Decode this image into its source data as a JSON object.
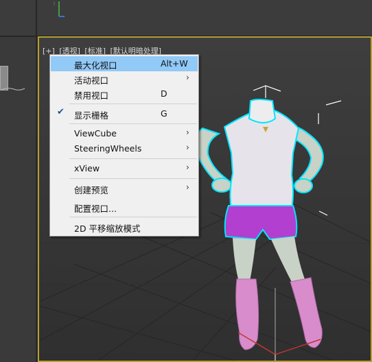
{
  "viewport_label": {
    "plus": "[+]",
    "view": "[透视]",
    "mode": "[标准]",
    "shading": "[默认明暗处理]"
  },
  "context_menu": {
    "items": [
      {
        "label": "最大化视口",
        "shortcut": "Alt+W",
        "submenu": false,
        "checked": false,
        "highlighted": true
      },
      {
        "label": "活动视口",
        "shortcut": "",
        "submenu": true,
        "checked": false,
        "highlighted": false
      },
      {
        "label": "禁用视口",
        "shortcut": "D",
        "submenu": false,
        "checked": false,
        "highlighted": false
      },
      {
        "label": "显示栅格",
        "shortcut": "G",
        "submenu": false,
        "checked": true,
        "highlighted": false
      },
      {
        "label": "ViewCube",
        "shortcut": "",
        "submenu": true,
        "checked": false,
        "highlighted": false
      },
      {
        "label": "SteeringWheels",
        "shortcut": "",
        "submenu": true,
        "checked": false,
        "highlighted": false
      },
      {
        "label": "xView",
        "shortcut": "",
        "submenu": true,
        "checked": false,
        "highlighted": false
      },
      {
        "label": "创建预览",
        "shortcut": "",
        "submenu": true,
        "checked": false,
        "highlighted": false
      },
      {
        "label": "配置视口...",
        "shortcut": "",
        "submenu": false,
        "checked": false,
        "highlighted": false
      },
      {
        "label": "2D 平移缩放模式",
        "shortcut": "",
        "submenu": false,
        "checked": false,
        "highlighted": false
      }
    ],
    "submenu_glyph": "›",
    "check_glyph": "✔"
  },
  "colors": {
    "highlight": "#91c9f7",
    "active_border": "#b8a033",
    "selection_outline": "#00e5ff",
    "shorts": "#b33fd1",
    "boots": "#d88ccb",
    "top": "#e6e4ea"
  }
}
